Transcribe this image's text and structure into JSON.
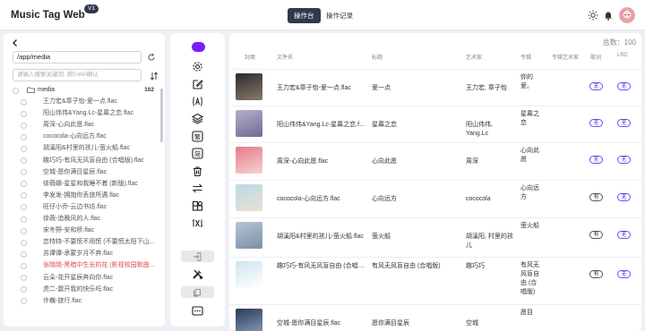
{
  "header": {
    "app_title": "Music Tag Web",
    "version": "V1",
    "tabs": [
      "操作台",
      "操作记录"
    ]
  },
  "left": {
    "path_value": "/app/media",
    "search_placeholder": "请输入搜索关键词, 按Enter确认",
    "folder": {
      "name": "media",
      "count": "102"
    },
    "files": [
      {
        "name": "王力宏&章子怡-爱一点.flac",
        "red": false
      },
      {
        "name": "阳山伟伟&Yang.Lc-星幕之恋.flac",
        "red": false
      },
      {
        "name": "周深-心向此愿.flac",
        "red": false
      },
      {
        "name": "cococola-心向远方.flac",
        "red": false
      },
      {
        "name": "胡溪阳&村里的孩儿-萤火船.flac",
        "red": false
      },
      {
        "name": "趣巧巧-有风无风盲自由 (合唱版).flac",
        "red": false
      },
      {
        "name": "空城-愿你满目星辰.flac",
        "red": false
      },
      {
        "name": "徐薇娜-星星和我睡不着 (新版).flac",
        "red": false
      },
      {
        "name": "李发发-拥抱你丢旅所遇.flac",
        "red": false
      },
      {
        "name": "旺仔小乔-云边书坊.flac",
        "red": false
      },
      {
        "name": "徐薇-追晚风的人.flac",
        "red": false
      },
      {
        "name": "宋冬野-安和桥.flac",
        "red": false
      },
      {
        "name": "恋特特-不要慌不用慌 (不要慌太阳下山...",
        "red": false
      },
      {
        "name": "苏谭谭-承蒙岁月不弃.flac",
        "red": false
      },
      {
        "name": "张晓晓-黑暗中生长的花 (影视校园歌曲...",
        "red": true
      },
      {
        "name": "云朵-花开星辰奔向你.flac",
        "red": false
      },
      {
        "name": "虎二-震开我的快乐吗.flac",
        "red": false
      },
      {
        "name": "许巍-旅行.flac",
        "red": false
      }
    ]
  },
  "toolbar": {
    "icons": [
      "settings-icon",
      "edit-icon",
      "text-format-icon",
      "layers-icon",
      "traditional-chinese-icon",
      "simplified-chinese-icon",
      "trash-icon",
      "swap-icon",
      "puzzle-icon",
      "translate-icon",
      "login-icon",
      "tools-icon",
      "copy-icon",
      "more-icon"
    ]
  },
  "table": {
    "total_label": "总数：100",
    "headers": [
      "封面",
      "文件名",
      "标题",
      "艺术家",
      "专辑",
      "专辑艺术家",
      "歌词",
      "LRC"
    ],
    "rows": [
      {
        "file": "王力宏&章子怡-爱一点.flac",
        "title": "爱一点",
        "artist": "王力宏, 章子怡",
        "album": "你的爱。",
        "lyrics": "无",
        "lrc": "无"
      },
      {
        "file": "阳山伟伟&Yang.Lc-星幕之恋.flac",
        "title": "星幕之恋",
        "artist": "阳山伟伟, Yang.Lc",
        "album": "星幕之恋",
        "lyrics": "无",
        "lrc": "无"
      },
      {
        "file": "周深-心向此愿.flac",
        "title": "心向此愿",
        "artist": "周深",
        "album": "心向此愿",
        "lyrics": "无",
        "lrc": "无"
      },
      {
        "file": "cococola-心向远方.flac",
        "title": "心向远方",
        "artist": "cococola",
        "album": "心向远方",
        "lyrics": "有",
        "lrc": "无"
      },
      {
        "file": "胡溪阳&村里的孩儿-萤火船.flac",
        "title": "萤火船",
        "artist": "胡溪阳, 村里的孩儿",
        "album": "萤火船",
        "lyrics": "有",
        "lrc": "无"
      },
      {
        "file": "趣巧巧-有风无风盲自由 (合唱版).flac",
        "title": "有风无风盲自由 (合唱版)",
        "artist": "趣巧巧",
        "album": "有风无风盲自由 (合唱版)",
        "lyrics": "有",
        "lrc": "无"
      },
      {
        "file": "空城-愿你满目星辰.flac",
        "title": "愿你满目星辰",
        "artist": "空城",
        "album": "愿目",
        "lyrics": "",
        "lrc": ""
      }
    ]
  }
}
